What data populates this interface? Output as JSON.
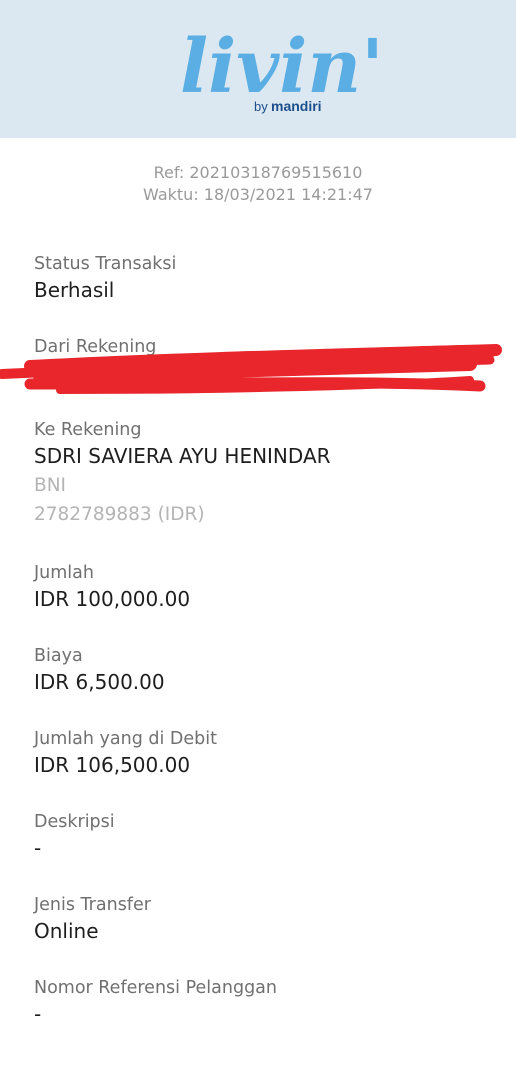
{
  "header": {
    "logo_word": "livin'",
    "logo_by": "by",
    "logo_brand": "mandiri",
    "background_color": "#dce8f1",
    "logo_color": "#5aaee3",
    "brand_text_color": "#1c4f8c",
    "accent_color": "#f5c518"
  },
  "receipt": {
    "ref": "Ref: 20210318769515610",
    "time": "Waktu: 18/03/2021 14:21:47"
  },
  "fields": {
    "status": {
      "label": "Status Transaksi",
      "value": "Berhasil"
    },
    "from_account": {
      "label": "Dari Rekening",
      "redacted": true,
      "redaction_color": "#e8262b"
    },
    "to_account": {
      "label": "Ke Rekening",
      "name": "SDRI SAVIERA AYU HENINDAR",
      "bank": "BNI",
      "account": "2782789883 (IDR)"
    },
    "amount": {
      "label": "Jumlah",
      "value": "IDR 100,000.00"
    },
    "fee": {
      "label": "Biaya",
      "value": "IDR 6,500.00"
    },
    "debited": {
      "label": "Jumlah yang di Debit",
      "value": "IDR 106,500.00"
    },
    "description": {
      "label": "Deskripsi",
      "value": "-"
    },
    "transfer_type": {
      "label": "Jenis Transfer",
      "value": "Online"
    },
    "customer_ref": {
      "label": "Nomor Referensi Pelanggan",
      "value": "-"
    }
  }
}
